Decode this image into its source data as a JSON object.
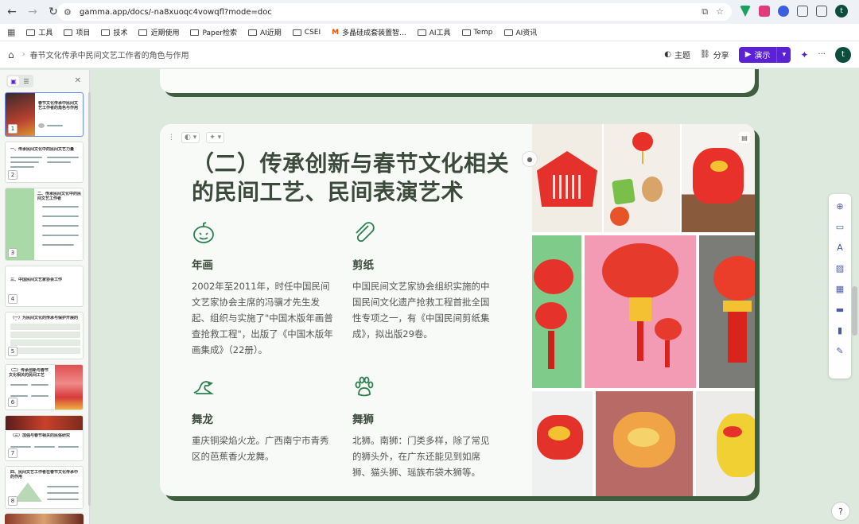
{
  "browser": {
    "url": "gamma.app/docs/-na8xuoqc4vowqfl?mode=doc",
    "profile_initial": "t",
    "bookmarks": [
      "工具",
      "项目",
      "技术",
      "近期使用",
      "Paper检索",
      "AI近期",
      "CSEI",
      "多晶硅成套装置智...",
      "AI工具",
      "Temp",
      "AI资讯"
    ]
  },
  "app": {
    "breadcrumb": "春节文化传承中民间文艺工作者的角色与作用",
    "theme_label": "主题",
    "share_label": "分享",
    "present_label": "演示",
    "avatar_initial": "t"
  },
  "sidebar": {
    "slides": [
      {
        "num": "1",
        "title": "春节文化传承中民间文艺工作者的角色与作用"
      },
      {
        "num": "2",
        "title": "一、传承民间文化中的民间文艺力量"
      },
      {
        "num": "3",
        "title": "二、传承民间文化中的民间文艺工作者"
      },
      {
        "num": "4",
        "title": "三、中国民间文艺家协会工作"
      },
      {
        "num": "5",
        "title": "（一）为民间文化的传承与保护开展的工作"
      },
      {
        "num": "6",
        "title": "（二）传承创新与春节文化相关的民间工艺"
      },
      {
        "num": "7",
        "title": "（三）加强与春节相关的民俗研究"
      },
      {
        "num": "8",
        "title": "四、民间文艺工作者在春节文化传承中的作用"
      }
    ]
  },
  "card": {
    "title": "（二）传承创新与春节文化相关的民间工艺、民间表演艺术",
    "items": [
      {
        "heading": "年画",
        "icon": "pumpkin-icon",
        "text": "2002年至2011年，时任中国民间文艺家协会主席的冯骥才先生发起、组织与实施了\"中国木版年画普查抢救工程\"，出版了《中国木版年画集成》（22册）。"
      },
      {
        "heading": "剪纸",
        "icon": "paperclip-icon",
        "text": "中国民间文艺家协会组织实施的中国民间文化遗产抢救工程首批全国性专项之一，有《中国民间剪纸集成》，拟出版29卷。"
      },
      {
        "heading": "舞龙",
        "icon": "dragon-icon",
        "text": "重庆铜梁焰火龙。广西南宁市青秀区的芭蕉香火龙舞。"
      },
      {
        "heading": "舞狮",
        "icon": "pawprint-icon",
        "text": "北狮。南狮：门类多样，除了常见的狮头外，在广东还能见到如席狮、猫头狮、瑶族布袋木狮等。"
      }
    ]
  },
  "colors": {
    "accent": "#5b21d6",
    "card_shadow": "#3f5e3f",
    "canvas_bg": "#dde9dd",
    "icon_green": "#2e7d4f"
  }
}
